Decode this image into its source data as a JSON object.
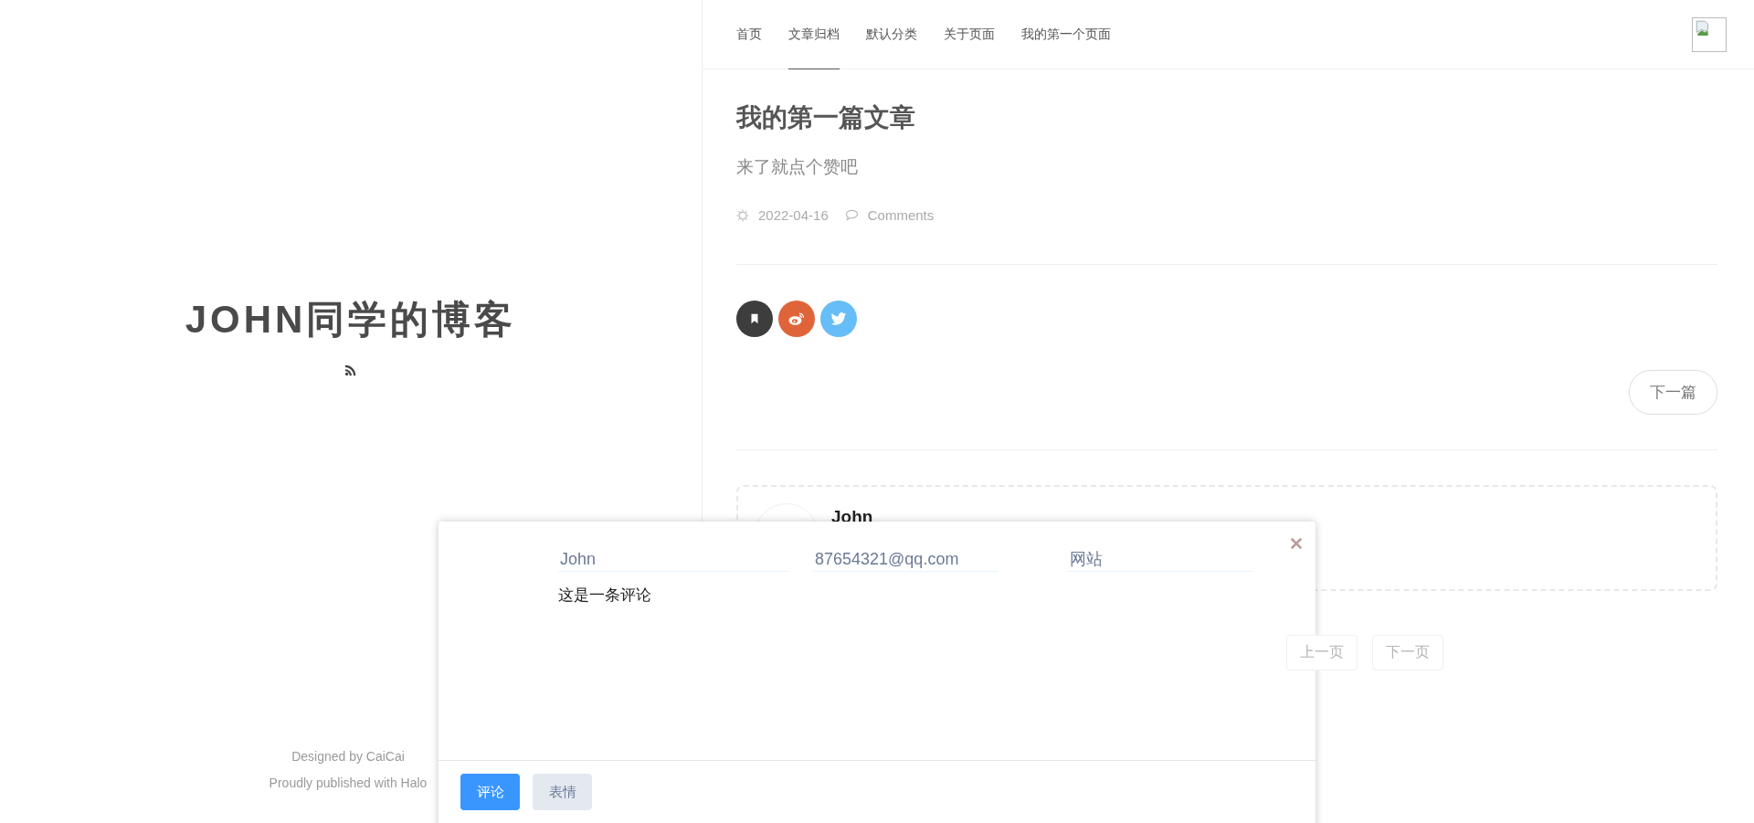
{
  "sidebar": {
    "blog_title": "JOHN同学的博客",
    "footer": [
      "Designed by CaiCai",
      "Proudly published with Halo"
    ]
  },
  "nav": {
    "items": [
      {
        "label": "首页",
        "selected": false
      },
      {
        "label": "文章归档",
        "selected": true
      },
      {
        "label": "默认分类",
        "selected": false
      },
      {
        "label": "关于页面",
        "selected": false
      },
      {
        "label": "我的第一个页面",
        "selected": false
      }
    ]
  },
  "post": {
    "title": "我的第一篇文章",
    "subtitle": "来了就点个赞吧",
    "date": "2022-04-16",
    "comments_label": "Comments",
    "share": [
      {
        "kind": "bookmark",
        "color": "#3d3d3d"
      },
      {
        "kind": "weibo",
        "color": "#e0643a"
      },
      {
        "kind": "twitter",
        "color": "#66bdf7"
      }
    ],
    "next_button": "下一篇"
  },
  "comments": [
    {
      "author": "John"
    }
  ],
  "pagination": [
    "上一页",
    "下一页"
  ],
  "comment_form": {
    "name": "John",
    "email": "87654321@qq.com",
    "website": {
      "placeholder": "网站"
    },
    "content": "这是一条评论",
    "buttons": [
      {
        "label": "评论",
        "kind": "primary"
      },
      {
        "label": "表情",
        "kind": "secondary"
      }
    ]
  }
}
